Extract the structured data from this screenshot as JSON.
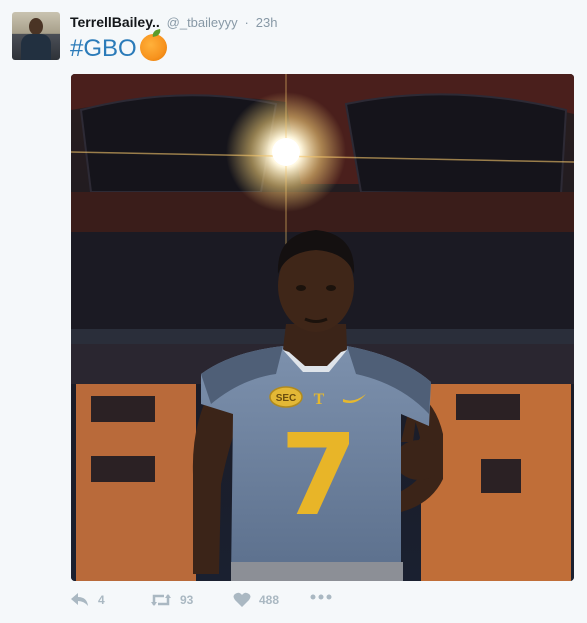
{
  "user": {
    "display_name": "TerrellBailey..",
    "handle": "@_tbaileyyy",
    "separator": "·",
    "time": "23h"
  },
  "tweet": {
    "text": "#GBO",
    "emoji": "orange-emoji"
  },
  "media": {
    "jersey_number": "7",
    "jersey_logo_text": "T",
    "jersey_patch_text": "SEC"
  },
  "actions": {
    "reply_count": "4",
    "retweet_count": "93",
    "like_count": "488"
  },
  "colors": {
    "link": "#2b7bb9",
    "muted": "#8899a6",
    "icon": "#aab8c2",
    "jersey": "#6e83a0",
    "jersey_number": "#e8b528"
  }
}
